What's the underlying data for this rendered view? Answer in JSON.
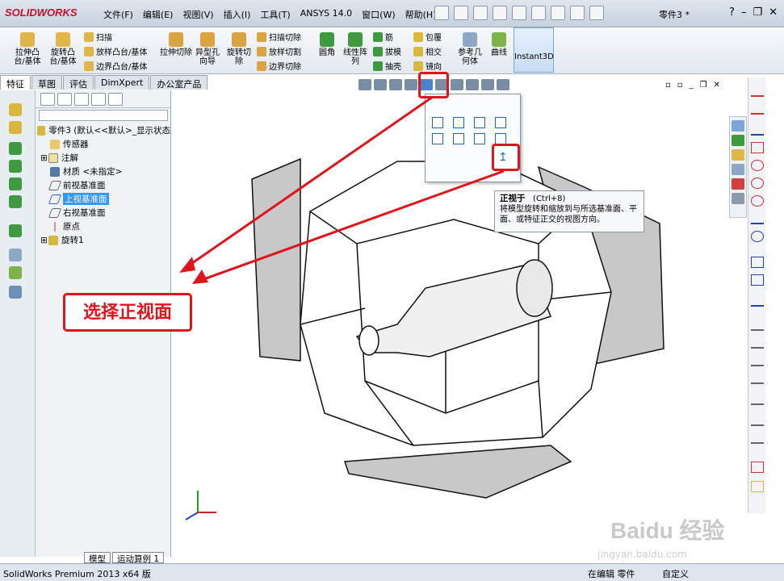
{
  "app": {
    "logo": "SOLIDWORKS",
    "document_title": "零件3 *",
    "status_product": "SolidWorks Premium 2013 x64 版",
    "status_mode": "在编辑 零件",
    "status_units": "自定义"
  },
  "menu": [
    "文件(F)",
    "编辑(E)",
    "视图(V)",
    "插入(I)",
    "工具(T)",
    "ANSYS 14.0",
    "窗口(W)",
    "帮助(H)"
  ],
  "ribbon": {
    "big": [
      "拉伸凸台/基体",
      "旋转凸台/基体",
      "拉伸切除",
      "异型孔向导",
      "旋转切除",
      "圆角",
      "线性阵列",
      "参考几何体",
      "曲线",
      "Instant3D"
    ],
    "small": [
      "扫描",
      "放样凸台/基体",
      "边界凸台/基体",
      "扫描切除",
      "放样切割",
      "边界切除",
      "筋",
      "拔模",
      "抽壳",
      "包覆",
      "相交",
      "镜向"
    ]
  },
  "tabs": [
    "特征",
    "草图",
    "评估",
    "DimXpert",
    "办公室产品"
  ],
  "tree": {
    "root": "零件3 (默认<<默认>_显示状态",
    "items": [
      "传感器",
      "注解",
      "材质 <未指定>",
      "前视基准面",
      "上视基准面",
      "右视基准面",
      "原点",
      "旋转1"
    ],
    "bottom_tabs": [
      "模型",
      "运动算例 1"
    ]
  },
  "tooltip": {
    "title": "正视于",
    "shortcut": "(Ctrl+8)",
    "body": "将模型旋转和缩放到与所选基准面、平面、或特征正交的视图方向。"
  },
  "callout": "选择正视面",
  "watermark": {
    "main": "Baidu 经验",
    "sub": "jingyan.baidu.com"
  },
  "colors": {
    "annotation_red": "#e0141b",
    "selection_blue": "#3399ff",
    "brand_red": "#c8102e"
  }
}
